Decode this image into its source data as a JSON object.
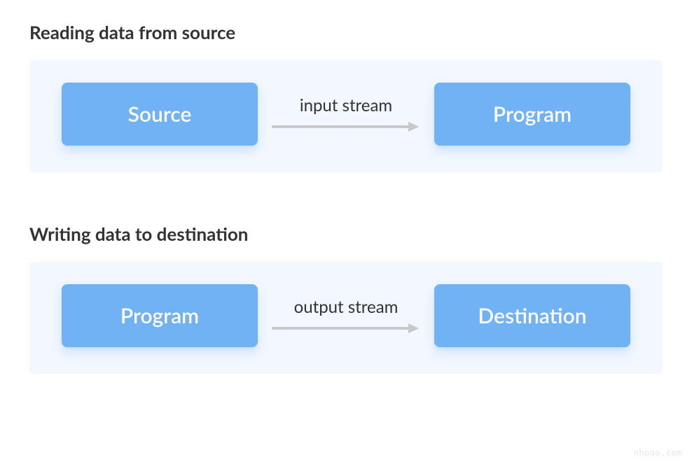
{
  "sections": [
    {
      "title": "Reading data from source",
      "left_node": "Source",
      "arrow_label": "input stream",
      "right_node": "Program"
    },
    {
      "title": "Writing data to destination",
      "left_node": "Program",
      "arrow_label": "output stream",
      "right_node": "Destination"
    }
  ],
  "watermark": "nhooo.com",
  "colors": {
    "node_bg": "#71b2f4",
    "node_text": "#ffffff",
    "panel_bg": "#f3f7ff",
    "title_color": "#333333",
    "arrow_color": "#c8c8c8"
  }
}
